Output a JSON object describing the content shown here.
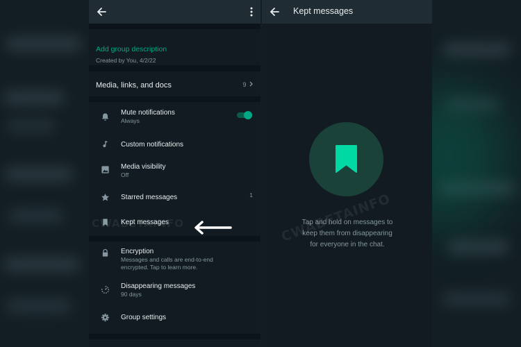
{
  "group_info": {
    "description": {
      "add_label": "Add group description",
      "created_by": "Created by You, 4/2/22"
    },
    "media": {
      "label": "Media, links, and docs",
      "count": "9"
    },
    "settings": [
      {
        "title": "Mute notifications",
        "subtitle": "Always",
        "icon": "bell-icon",
        "toggle_on": true
      },
      {
        "title": "Custom notifications",
        "icon": "music-note-icon"
      },
      {
        "title": "Media visibility",
        "subtitle": "Off",
        "icon": "image-icon"
      },
      {
        "title": "Starred messages",
        "badge": "1",
        "icon": "star-icon"
      },
      {
        "title": "Kept messages",
        "icon": "bookmark-icon",
        "highlighted": true
      }
    ],
    "security": [
      {
        "title": "Encryption",
        "subtitle_lines": [
          "Messages and calls are end-to-end",
          "encrypted. Tap to learn more."
        ],
        "icon": "lock-icon"
      },
      {
        "title": "Disappearing messages",
        "subtitle": "90 days",
        "icon": "timer-icon"
      },
      {
        "title": "Group settings",
        "icon": "gear-icon"
      }
    ]
  },
  "kept_messages": {
    "title": "Kept messages",
    "empty_state_lines": [
      "Tap and hold on messages to",
      "keep them from disappearing",
      "for everyone in the chat."
    ],
    "icon": "bookmark-icon"
  },
  "colors": {
    "accent": "#00a884",
    "background": "#111b21",
    "topbar": "#1f2c33",
    "primary_text": "#e9edef",
    "secondary_text": "#8696a0"
  },
  "watermark": "CWABETAINFO"
}
